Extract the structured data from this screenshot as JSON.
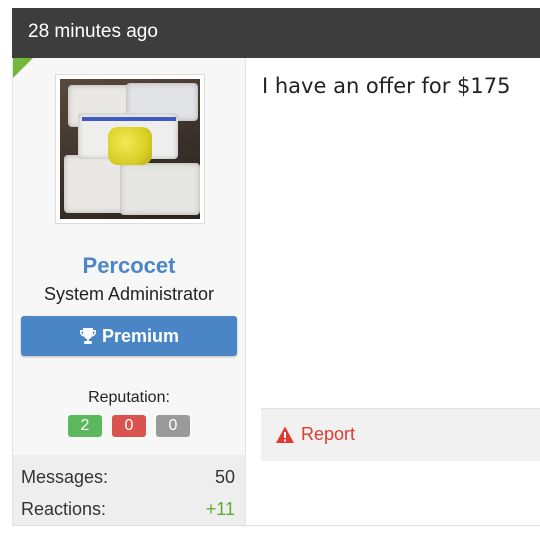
{
  "post": {
    "time_ago": "28 minutes ago",
    "message": "I have an offer for $175"
  },
  "user": {
    "name": "Percocet",
    "title": "System Administrator",
    "badge_label": "Premium",
    "badge_icon": "trophy-icon",
    "reputation_label": "Reputation:",
    "reputation": {
      "positive": "2",
      "negative": "0",
      "neutral": "0"
    },
    "stats": [
      {
        "label": "Messages:",
        "value": "50"
      },
      {
        "label": "Reactions:",
        "value": "+11"
      }
    ]
  },
  "actions": {
    "report_label": "Report",
    "report_icon": "warning-icon"
  },
  "colors": {
    "header_bg": "#3d3d3d",
    "username": "#4b86c6",
    "premium_bg": "#4a86c5",
    "rep_positive": "#5cb85c",
    "rep_negative": "#d9534f",
    "rep_neutral": "#9a9a9a",
    "report": "#e03c31",
    "corner_marker": "#74b83b"
  }
}
